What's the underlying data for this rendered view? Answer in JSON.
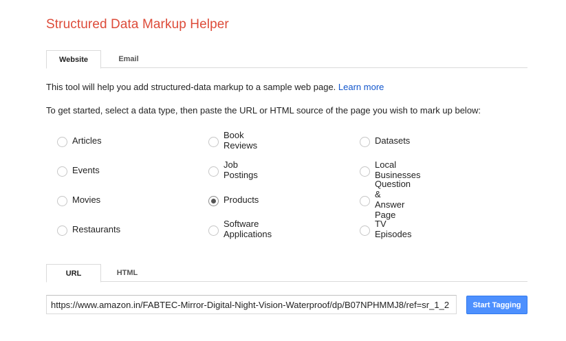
{
  "title": "Structured Data Markup Helper",
  "top_tabs": [
    {
      "label": "Website",
      "active": true
    },
    {
      "label": "Email",
      "active": false
    }
  ],
  "intro": {
    "text": "This tool will help you add structured-data markup to a sample web page.",
    "link": "Learn more"
  },
  "instructions": "To get started, select a data type, then paste the URL or HTML source of the page you wish to mark up below:",
  "data_types": [
    {
      "label": "Articles",
      "selected": false
    },
    {
      "label": "Book Reviews",
      "selected": false
    },
    {
      "label": "Datasets",
      "selected": false
    },
    {
      "label": "Events",
      "selected": false
    },
    {
      "label": "Job Postings",
      "selected": false
    },
    {
      "label": "Local Businesses",
      "selected": false
    },
    {
      "label": "Movies",
      "selected": false
    },
    {
      "label": "Products",
      "selected": true
    },
    {
      "label": "Question & Answer Page",
      "selected": false
    },
    {
      "label": "Restaurants",
      "selected": false
    },
    {
      "label": "Software Applications",
      "selected": false
    },
    {
      "label": "TV Episodes",
      "selected": false
    }
  ],
  "source_tabs": [
    {
      "label": "URL",
      "active": true
    },
    {
      "label": "HTML",
      "active": false
    }
  ],
  "url_input": {
    "value": "https://www.amazon.in/FABTEC-Mirror-Digital-Night-Vision-Waterproof/dp/B07NPHMMJ8/ref=sr_1_2"
  },
  "start_button": "Start Tagging",
  "colors": {
    "title": "#dd4b39",
    "link": "#1155cc",
    "button": "#4d90fe"
  }
}
